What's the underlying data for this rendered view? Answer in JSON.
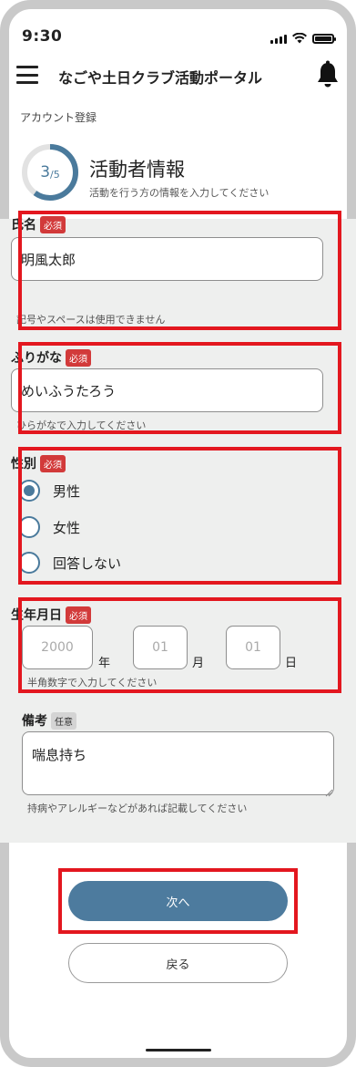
{
  "status_bar": {
    "time": "9:30"
  },
  "header": {
    "title": "なごや土日クラブ活動ポータル",
    "menu_icon": "hamburger-menu-icon",
    "notify_icon": "bell-icon"
  },
  "breadcrumb": "アカウント登録",
  "step": {
    "current": "3",
    "total": "/5",
    "progress": 0.6,
    "accent": "#4a7a9c"
  },
  "section": {
    "title": "活動者情報",
    "subtitle": "活動を行う方の情報を入力してください"
  },
  "badges": {
    "required": "必須",
    "optional": "任意"
  },
  "fields": {
    "name": {
      "label": "氏名",
      "value": "明風太郎",
      "hint": "記号やスペースは使用できません"
    },
    "kana": {
      "label": "ふりがな",
      "value": "めいふうたろう",
      "hint": "ひらがなで入力してください"
    },
    "gender": {
      "label": "性別",
      "options": [
        "男性",
        "女性",
        "回答しない"
      ],
      "selected": "男性"
    },
    "birthday": {
      "label": "生年月日",
      "year_placeholder": "2000",
      "month_placeholder": "01",
      "day_placeholder": "01",
      "year_unit": "年",
      "month_unit": "月",
      "day_unit": "日",
      "hint": "半角数字で入力してください"
    },
    "notes": {
      "label": "備考",
      "value": "喘息持ち",
      "hint": "持病やアレルギーなどがあれば記載してください"
    }
  },
  "buttons": {
    "next": "次へ",
    "back": "戻る"
  },
  "colors": {
    "primary": "#4d7b9e",
    "required_badge": "#d23a3a",
    "highlight": "#e3171f"
  }
}
